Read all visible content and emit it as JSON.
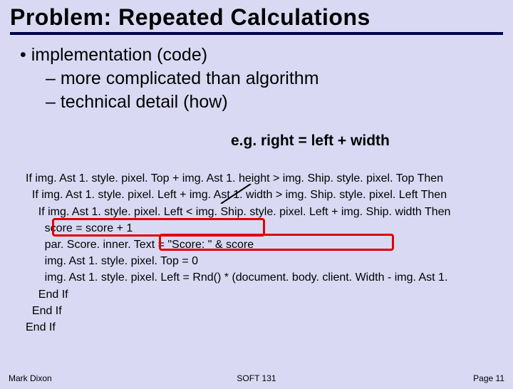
{
  "title": "Problem: Repeated Calculations",
  "bullet": "implementation (code)",
  "sub1": "– more complicated than algorithm",
  "sub2": "– technical detail (how)",
  "example": "e.g. right = left + width",
  "code": {
    "l1": "If img. Ast 1. style. pixel. Top + img. Ast 1. height > img. Ship. style. pixel. Top Then",
    "l2": "  If img. Ast 1. style. pixel. Left + img. Ast 1. width > img. Ship. style. pixel. Left Then",
    "l3": "    If img. Ast 1. style. pixel. Left < img. Ship. style. pixel. Left + img. Ship. width Then",
    "l4": "      score = score + 1",
    "l5": "      par. Score. inner. Text = \"Score: \" & score",
    "l6": "      img. Ast 1. style. pixel. Top = 0",
    "l7": "      img. Ast 1. style. pixel. Left = Rnd() * (document. body. client. Width - img. Ast 1.",
    "l8": "    End If",
    "l9": "  End If",
    "l10": "End If"
  },
  "footer": {
    "left": "Mark Dixon",
    "center": "SOFT 131",
    "right": "Page 11"
  }
}
